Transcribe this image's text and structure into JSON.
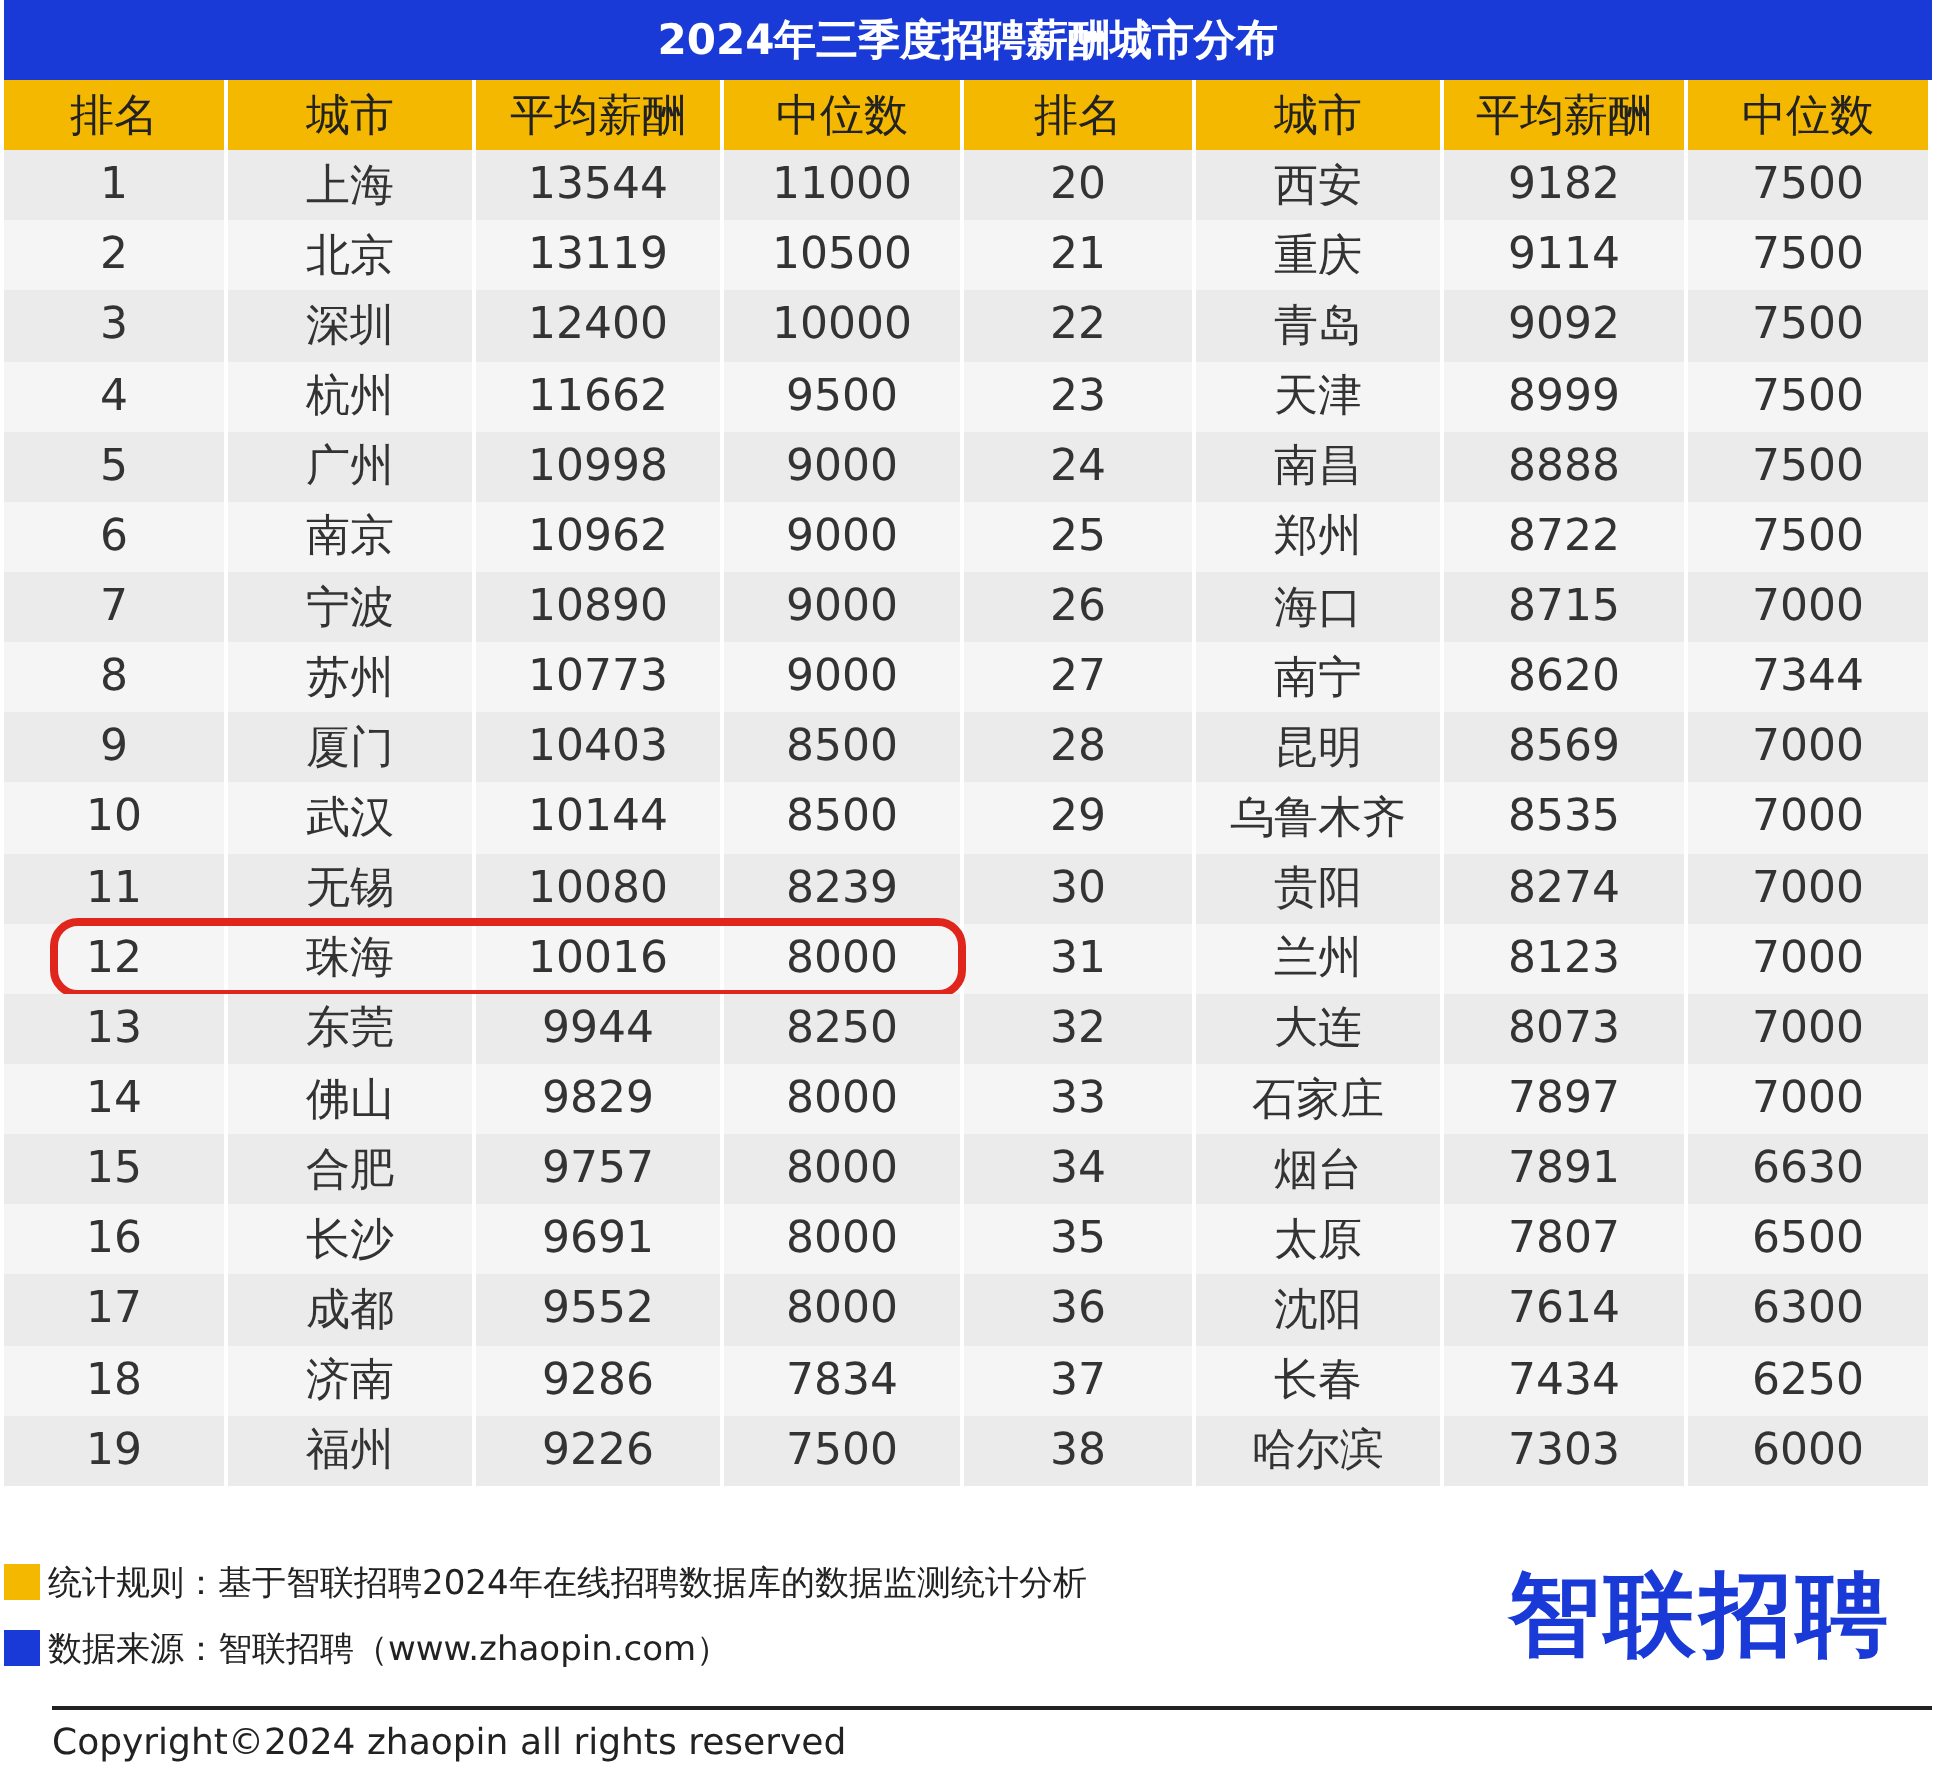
{
  "title": "2024年三季度招聘薪酬城市分布",
  "table": {
    "columns": [
      "排名",
      "城市",
      "平均薪酬",
      "中位数",
      "排名",
      "城市",
      "平均薪酬",
      "中位数"
    ],
    "rows": [
      {
        "cells": [
          "1",
          "上海",
          "13544",
          "11000",
          "20",
          "西安",
          "9182",
          "7500"
        ],
        "highlighted": false
      },
      {
        "cells": [
          "2",
          "北京",
          "13119",
          "10500",
          "21",
          "重庆",
          "9114",
          "7500"
        ],
        "highlighted": false
      },
      {
        "cells": [
          "3",
          "深圳",
          "12400",
          "10000",
          "22",
          "青岛",
          "9092",
          "7500"
        ],
        "highlighted": false
      },
      {
        "cells": [
          "4",
          "杭州",
          "11662",
          "9500",
          "23",
          "天津",
          "8999",
          "7500"
        ],
        "highlighted": false
      },
      {
        "cells": [
          "5",
          "广州",
          "10998",
          "9000",
          "24",
          "南昌",
          "8888",
          "7500"
        ],
        "highlighted": false
      },
      {
        "cells": [
          "6",
          "南京",
          "10962",
          "9000",
          "25",
          "郑州",
          "8722",
          "7500"
        ],
        "highlighted": false
      },
      {
        "cells": [
          "7",
          "宁波",
          "10890",
          "9000",
          "26",
          "海口",
          "8715",
          "7000"
        ],
        "highlighted": false
      },
      {
        "cells": [
          "8",
          "苏州",
          "10773",
          "9000",
          "27",
          "南宁",
          "8620",
          "7344"
        ],
        "highlighted": false
      },
      {
        "cells": [
          "9",
          "厦门",
          "10403",
          "8500",
          "28",
          "昆明",
          "8569",
          "7000"
        ],
        "highlighted": false
      },
      {
        "cells": [
          "10",
          "武汉",
          "10144",
          "8500",
          "29",
          "乌鲁木齐",
          "8535",
          "7000"
        ],
        "highlighted": false
      },
      {
        "cells": [
          "11",
          "无锡",
          "10080",
          "8239",
          "30",
          "贵阳",
          "8274",
          "7000"
        ],
        "highlighted": false
      },
      {
        "cells": [
          "12",
          "珠海",
          "10016",
          "8000",
          "31",
          "兰州",
          "8123",
          "7000"
        ],
        "highlighted": true
      },
      {
        "cells": [
          "13",
          "东莞",
          "9944",
          "8250",
          "32",
          "大连",
          "8073",
          "7000"
        ],
        "highlighted": false
      },
      {
        "cells": [
          "14",
          "佛山",
          "9829",
          "8000",
          "33",
          "石家庄",
          "7897",
          "7000"
        ],
        "highlighted": false
      },
      {
        "cells": [
          "15",
          "合肥",
          "9757",
          "8000",
          "34",
          "烟台",
          "7891",
          "6630"
        ],
        "highlighted": false
      },
      {
        "cells": [
          "16",
          "长沙",
          "9691",
          "8000",
          "35",
          "太原",
          "7807",
          "6500"
        ],
        "highlighted": false
      },
      {
        "cells": [
          "17",
          "成都",
          "9552",
          "8000",
          "36",
          "沈阳",
          "7614",
          "6300"
        ],
        "highlighted": false
      },
      {
        "cells": [
          "18",
          "济南",
          "9286",
          "7834",
          "37",
          "长春",
          "7434",
          "6250"
        ],
        "highlighted": false
      },
      {
        "cells": [
          "19",
          "福州",
          "9226",
          "7500",
          "38",
          "哈尔滨",
          "7303",
          "6000"
        ],
        "highlighted": false
      }
    ]
  },
  "notes": [
    {
      "text": "统计规则：基于智联招聘2024年在线招聘数据库的数据监测统计分析",
      "color": "#f5b800"
    },
    {
      "text": "数据来源：智联招聘（www.zhaopin.com）",
      "color": "#1a3ad8"
    }
  ],
  "logo": "智联招聘",
  "copyright": "Copyright©2024 zhaopin all rights reserved"
}
